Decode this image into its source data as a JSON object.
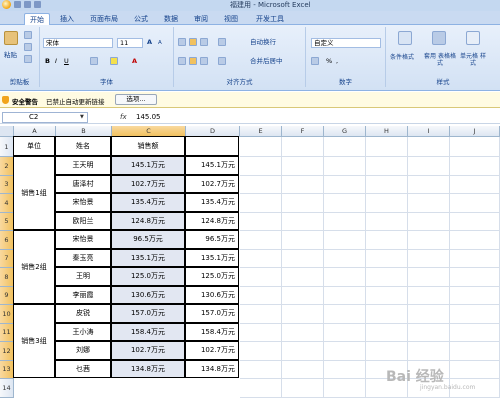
{
  "window": {
    "title": "福建用 - Microsoft Excel"
  },
  "tabs": [
    "开始",
    "插入",
    "页面布局",
    "公式",
    "数据",
    "审阅",
    "视图",
    "开发工具"
  ],
  "ribbon": {
    "clipboard": {
      "paste": "粘贴",
      "label": "剪贴板"
    },
    "font": {
      "name": "宋体",
      "size": "11",
      "label": "字体",
      "bold": "B",
      "italic": "I",
      "underline": "U",
      "grow": "A",
      "shrink": "A",
      "color_letter": "A"
    },
    "alignment": {
      "wrap": "自动换行",
      "merge": "合并后居中",
      "label": "对齐方式"
    },
    "number": {
      "format": "自定义",
      "label": "数字",
      "percent": "%",
      "comma": ","
    },
    "styles": {
      "conditional": "条件格式",
      "table": "套用 表格格式",
      "cell": "单元格 样式",
      "label": "样式"
    }
  },
  "security": {
    "title": "安全警告",
    "message": "已禁止自动更新链接",
    "button": "选项..."
  },
  "formula_bar": {
    "name_box": "C2",
    "fx": "fx",
    "value": "145.05"
  },
  "columns": [
    "A",
    "B",
    "C",
    "D",
    "E",
    "F",
    "G",
    "H",
    "I",
    "J"
  ],
  "rows": [
    "1",
    "2",
    "3",
    "4",
    "5",
    "6",
    "7",
    "8",
    "9",
    "10",
    "11",
    "12",
    "13",
    "14"
  ],
  "headers": {
    "a": "单位",
    "b": "姓名",
    "c": "销售额"
  },
  "groups": [
    "销售1组",
    "销售2组",
    "销售3组"
  ],
  "records": [
    {
      "name": "王天明",
      "c": "145.1万元",
      "d": "145.1万元"
    },
    {
      "name": "唐泽村",
      "c": "102.7万元",
      "d": "102.7万元"
    },
    {
      "name": "宋怡景",
      "c": "135.4万元",
      "d": "135.4万元"
    },
    {
      "name": "欧阳兰",
      "c": "124.8万元",
      "d": "124.8万元"
    },
    {
      "name": "宋怡景",
      "c": "96.5万元",
      "d": "96.5万元"
    },
    {
      "name": "秦玉亮",
      "c": "135.1万元",
      "d": "135.1万元"
    },
    {
      "name": "王明",
      "c": "125.0万元",
      "d": "125.0万元"
    },
    {
      "name": "李丽霞",
      "c": "130.6万元",
      "d": "130.6万元"
    },
    {
      "name": "皮锐",
      "c": "157.0万元",
      "d": "157.0万元"
    },
    {
      "name": "王小涛",
      "c": "158.4万元",
      "d": "158.4万元"
    },
    {
      "name": "刘娜",
      "c": "102.7万元",
      "d": "102.7万元"
    },
    {
      "name": "乜茜",
      "c": "134.8万元",
      "d": "134.8万元"
    }
  ],
  "watermark": {
    "main": "Bai 经验",
    "sub": "jingyan.baidu.com"
  }
}
